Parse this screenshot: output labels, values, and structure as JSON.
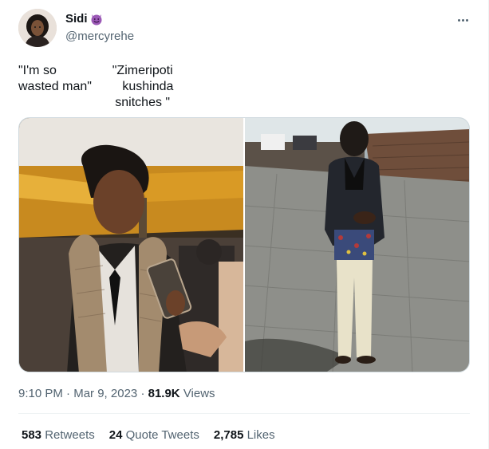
{
  "user": {
    "display_name": "Sidi",
    "handle": "@mercyrehe",
    "name_emoji": "smiling-devil-emoji"
  },
  "tweet": {
    "text_left": "\"I'm so\nwasted man\"",
    "text_right": "\"Zimeripoti\n   kushinda\nsnitches \""
  },
  "meta": {
    "time": "9:10 PM",
    "sep1": "·",
    "date": "Mar 9, 2023",
    "sep2": "·",
    "views_count": "81.9K",
    "views_label": "Views"
  },
  "stats": {
    "retweets_count": "583",
    "retweets_label": "Retweets",
    "quotes_count": "24",
    "quotes_label": "Quote Tweets",
    "likes_count": "2,785",
    "likes_label": "Likes"
  },
  "colors": {
    "text": "#0f1419",
    "secondary": "#536471",
    "border": "#cfd9de",
    "emoji_purple": "#8e44ad"
  }
}
